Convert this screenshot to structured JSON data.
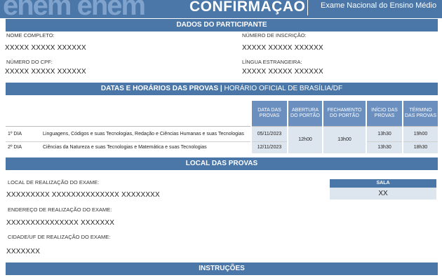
{
  "header": {
    "logo_text": "enem enem",
    "title": "CONFIRMAÇÃO",
    "subtitle": "Exame Nacional do Ensino Médio"
  },
  "participante": {
    "section_title": "DADOS DO PARTICIPANTE",
    "nome_label": "NOME COMPLETO:",
    "nome_value": "XXXXX XXXXX XXXXXX",
    "inscricao_label": "NÚMERO DE INSCRIÇÃO:",
    "inscricao_value": "XXXXX XXXXX XXXXXX",
    "cpf_label": "NÚMERO DO CPF:",
    "cpf_value": "XXXXX XXXXX XXXXXX",
    "lingua_label": "LÍNGUA ESTRANGEIRA:",
    "lingua_value": "XXXXX XXXXX XXXXXX"
  },
  "provas": {
    "section_title": "DATAS E HORÁRIOS DAS PROVAS |",
    "section_title_light": " HORÁRIO OFICIAL DE BRASÍLIA/DF",
    "headers": [
      "DATA DAS PROVAS",
      "ABERTURA DO PORTÃO",
      "FECHAMENTO DO PORTÃO",
      "INÍCIO DAS PROVAS",
      "TÉRMINO DAS PROVAS"
    ],
    "rows": [
      {
        "dia": "1º DIA",
        "area": "Linguagens, Códigos e suas Tecnologias, Redação e Ciências Humanas e suas Tecnologias",
        "data": "05/11/2023",
        "inicio": "13h30",
        "termino": "19h00"
      },
      {
        "dia": "2º DIA",
        "area": "Ciências da Natureza e suas Tecnologias e Matemática e suas Tecnologias",
        "data": "12/11/2023",
        "inicio": "13h30",
        "termino": "18h30"
      }
    ],
    "abertura": "12h00",
    "fechamento": "13h00"
  },
  "local": {
    "section_title": "LOCAL DAS PROVAS",
    "local_label": "LOCAL DE REALIZAÇÃO DO EXAME:",
    "local_value": "XXXXXXXXX XXXXXXXXXXXXXX XXXXXXXX",
    "endereco_label": "ENDEREÇO DE REALIZAÇÃO DO EXAME:",
    "endereco_value": "XXXXXXXXXXXXXXX XXXXXXX",
    "cidade_label": "CIDADE/UF DE REALIZAÇÃO DO EXAME:",
    "cidade_value": "XXXXXXX",
    "sala_label": "SALA",
    "sala_value": "XX"
  },
  "instrucoes": {
    "section_title": "INSTRUÇÕES"
  }
}
